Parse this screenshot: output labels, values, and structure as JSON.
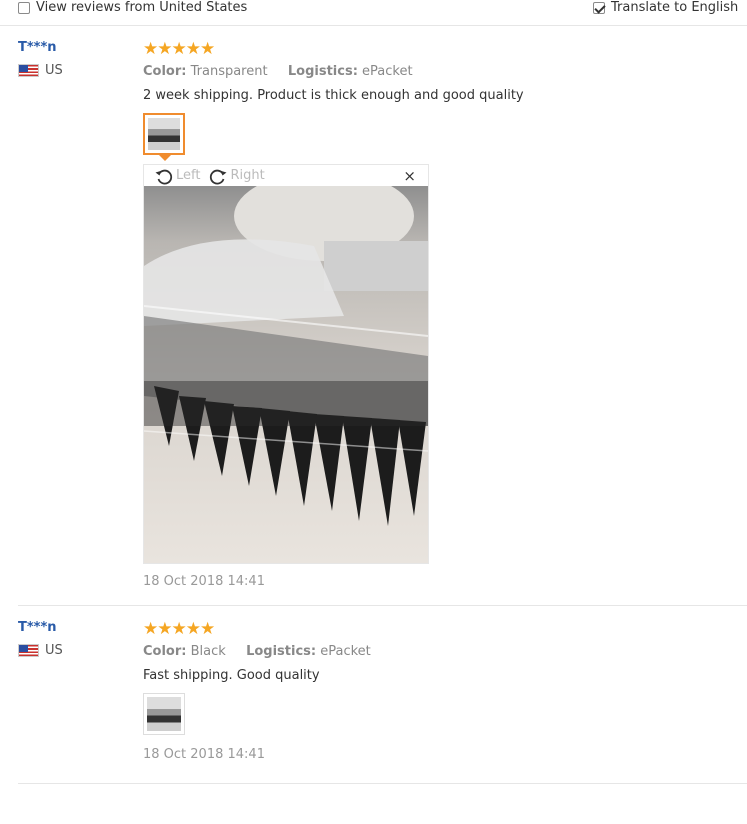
{
  "filters": {
    "view_us": {
      "label": "View reviews from United States",
      "checked": false
    },
    "translate": {
      "label": "Translate to English",
      "checked": true
    }
  },
  "viewer": {
    "rotate_left": "Left",
    "rotate_right": "Right",
    "close": "×"
  },
  "reviews": [
    {
      "user": "T***n",
      "country": "US",
      "stars": "★★★★★",
      "rating": 5,
      "color_label": "Color:",
      "color_value": "Transparent",
      "logistics_label": "Logistics:",
      "logistics_value": "ePacket",
      "text": "2 week shipping. Product is thick enough and good quality",
      "date": "18 Oct 2018 14:41"
    },
    {
      "user": "T***n",
      "country": "US",
      "stars": "★★★★★",
      "rating": 5,
      "color_label": "Color:",
      "color_value": "Black",
      "logistics_label": "Logistics:",
      "logistics_value": "ePacket",
      "text": "Fast shipping. Good quality",
      "date": "18 Oct 2018 14:41"
    }
  ],
  "colors": {
    "username": "#2a5ba8",
    "stars": "#f5a623",
    "active_thumb": "#f08c2e"
  }
}
